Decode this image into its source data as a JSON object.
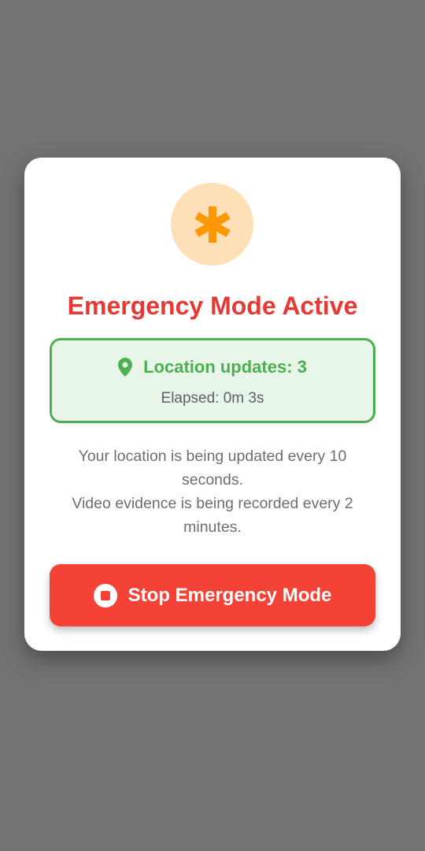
{
  "dialog": {
    "icon": "asterisk-icon",
    "title": "Emergency Mode Active",
    "status": {
      "icon": "location-pin-icon",
      "label": "Location updates: 3",
      "elapsed": "Elapsed: 0m 3s"
    },
    "info_lines": [
      "Your location is being updated every 10 seconds.",
      "Video evidence is being recorded every 2 minutes."
    ],
    "stop_button": {
      "icon": "stop-circle-icon",
      "label": "Stop Emergency Mode"
    }
  },
  "colors": {
    "backdrop": "#737373",
    "accent_orange": "#ff9800",
    "icon_circle_bg": "#fde0b8",
    "title_red": "#e53935",
    "status_green": "#4caf50",
    "status_bg": "#e8f5e9",
    "button_red": "#f44336"
  }
}
